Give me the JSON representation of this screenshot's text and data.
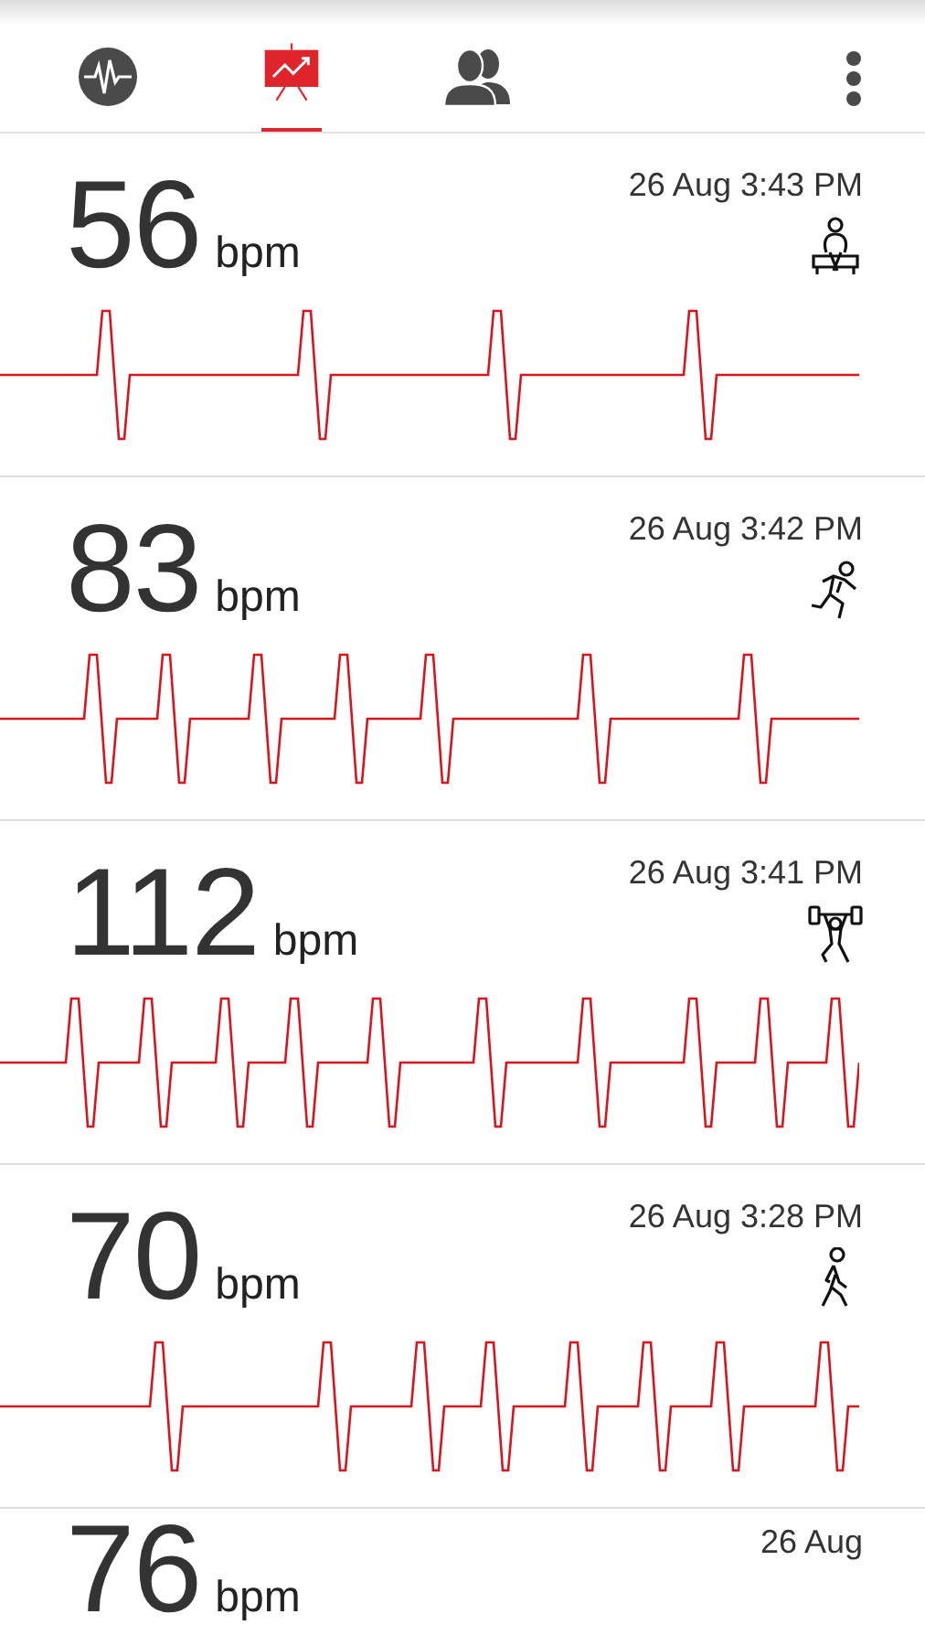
{
  "tabs": [
    {
      "selected": false
    },
    {
      "selected": true
    },
    {
      "selected": false
    }
  ],
  "readings": [
    {
      "value": "56",
      "unit": "bpm",
      "time": "26 Aug 3:43 PM",
      "kind": "rest"
    },
    {
      "value": "83",
      "unit": "bpm",
      "time": "26 Aug 3:42 PM",
      "kind": "run"
    },
    {
      "value": "112",
      "unit": "bpm",
      "time": "26 Aug 3:41 PM",
      "kind": "lift"
    },
    {
      "value": "70",
      "unit": "bpm",
      "time": "26 Aug 3:28 PM",
      "kind": "walk"
    },
    {
      "value": "76",
      "unit": "bpm",
      "time": "26 Aug"
    }
  ]
}
